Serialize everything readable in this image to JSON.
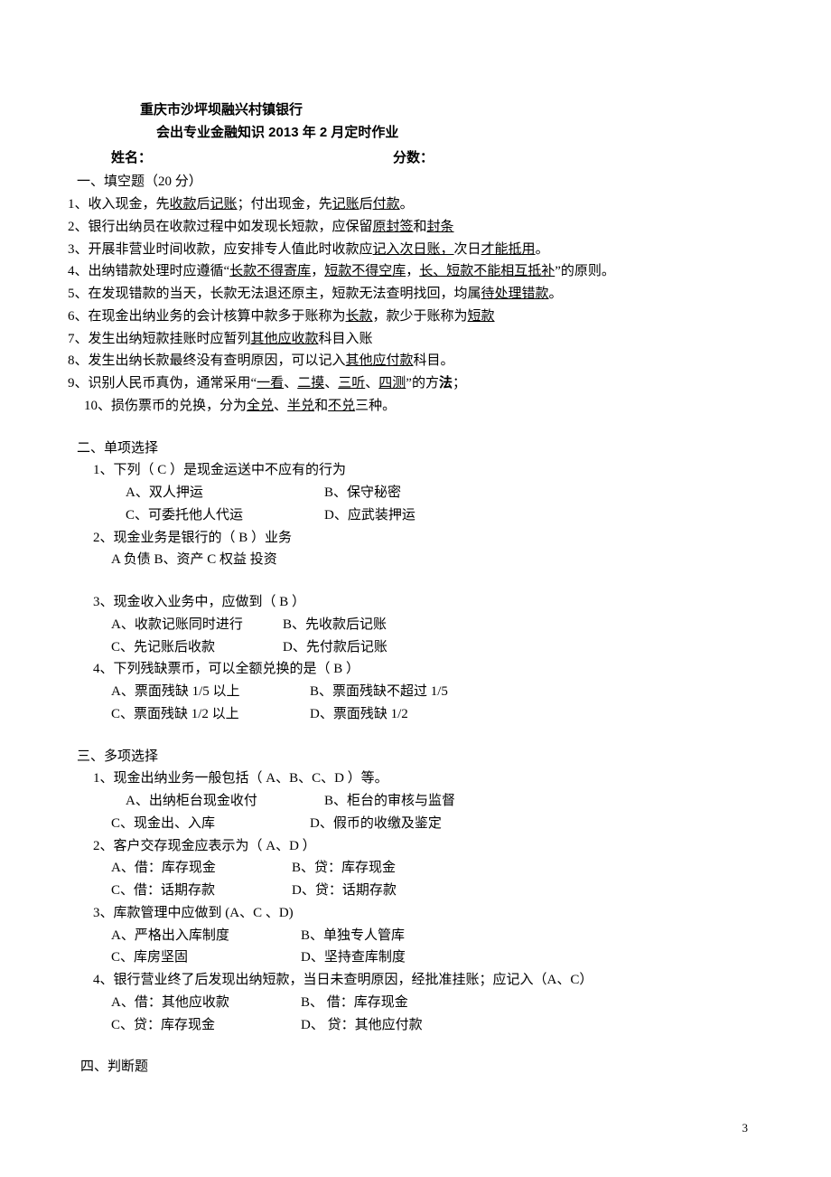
{
  "header": {
    "org": "重庆市沙坪坝融兴村镇银行",
    "subtitle": "会出专业金融知识 2013 年 2 月定时作业",
    "name_label": "姓名：",
    "score_label": "分数："
  },
  "sections": {
    "s1_title": "一、填空题（20 分）"
  },
  "fill": {
    "l1_a": "1、收入现金，先",
    "l1_u1": "收款",
    "l1_b": "后",
    "l1_u2": "记账",
    "l1_c": "；付出现金，先",
    "l1_u3": "记账",
    "l1_d": "后",
    "l1_u4": "付款",
    "l1_e": "。",
    "l2_a": "2、银行出纳员在收款过程中如发现长短款，应保留",
    "l2_u1": "原封签",
    "l2_b": "和",
    "l2_u2": "封条",
    "l3_a": "3、开展非营业时间收款，应安排专人值此时收款应",
    "l3_u1": "记入次日账，",
    "l3_b": "次日",
    "l3_u2": "才能抵用",
    "l3_c": "。",
    "l4_a": "4、出纳错款处理时应遵循“",
    "l4_u1": "长款不得寄库",
    "l4_b": "，",
    "l4_u2": "短款不得空库",
    "l4_c": "，",
    "l4_u3": "长、短款不能相互抵补",
    "l4_d": "”的原则。",
    "l5_a": "5、在发现错款的当天，长款无法退还原主，短款无法查明找回，均属",
    "l5_u1": "待处理错款",
    "l5_b": "。",
    "l6_a": "6、在现金出纳业务的会计核算中款多于账称为",
    "l6_u1": "长款",
    "l6_b": "，款少于账称为",
    "l6_u2": "短款",
    "l7_a": "7、发生出纳短款挂账时应暂列",
    "l7_u1": "其他应收款",
    "l7_b": "科目入账",
    "l8_a": "8、发生出纳长款最终没有查明原因，可以记入",
    "l8_u1": "其他应付款",
    "l8_b": "科目。",
    "l9_a": "9、识别人民币真伪，通常采用“",
    "l9_u1": "一看",
    "l9_s1": "、",
    "l9_u2": "二摸",
    "l9_s2": "、",
    "l9_u3": "三听",
    "l9_s3": "、",
    "l9_u4": "四测",
    "l9_b": "”的方",
    "l9_bold": "法",
    "l9_c": "；",
    "l10_a": "10、损伤票币的兑换，分为",
    "l10_u1": "全兑",
    "l10_s1": "、",
    "l10_u2": "半兑",
    "l10_b": "和",
    "l10_u3": "不兑",
    "l10_c": "三种。"
  },
  "single": {
    "title": "二、单项选择",
    "q1": "1、下列（  C  ）是现金运送中不应有的行为",
    "q1a": "A、双人押运",
    "q1b": "B、保守秘密",
    "q1c": "C、可委托他人代运",
    "q1d": "D、应武装押运",
    "q2": "2、现金业务是银行的（  B  ）业务",
    "q2opts": "A 负债      B、资产      C 权益      投资",
    "q3": "3、现金收入业务中，应做到（ B    ）",
    "q3a": "A、收款记账同时进行",
    "q3b": "B、先收款后记账",
    "q3c": "C、先记账后收款",
    "q3d": "D、先付款后记账",
    "q4": "4、下列残缺票币，可以全额兑换的是（ B ）",
    "q4a": "A、票面残缺 1/5 以上",
    "q4b": "B、票面残缺不超过 1/5",
    "q4c": "C、票面残缺 1/2 以上",
    "q4d": "D、票面残缺 1/2"
  },
  "multi": {
    "title": "三、多项选择",
    "q1": "1、现金出纳业务一般包括（ A、B、C、D ）等。",
    "q1a": "A、出纳柜台现金收付",
    "q1b": "B、柜台的审核与监督",
    "q1c": "C、现金出、入库",
    "q1d": "D、假币的收缴及鉴定",
    "q2": "2、客户交存现金应表示为（ A、D ）",
    "q2a": "A、借：库存现金",
    "q2b": "B、贷：库存现金",
    "q2c": "C、借：话期存款",
    "q2d": "D、贷：话期存款",
    "q3": "3、库款管理中应做到 (A、C 、D)",
    "q3a": "A、严格出入库制度",
    "q3b": "B、单独专人管库",
    "q3c": "C、库房坚固",
    "q3d": "D、坚持查库制度",
    "q4": "4、银行营业终了后发现出纳短款，当日未查明原因，经批准挂账；应记入（A、C）",
    "q4a": "A、借：其他应收款",
    "q4b": "B、  借：库存现金",
    "q4c": "C、贷：库存现金",
    "q4d": "D、  贷：其他应付款"
  },
  "judge": {
    "title": "四、判断题"
  },
  "page_number": "3"
}
